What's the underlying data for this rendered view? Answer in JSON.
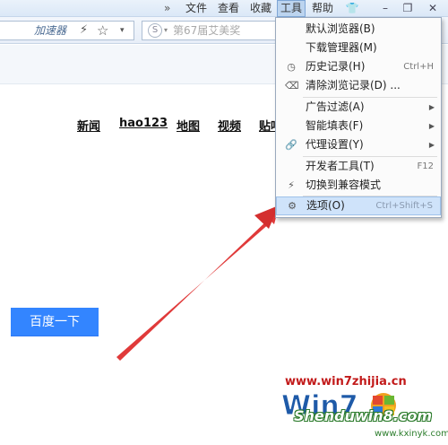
{
  "menubar": {
    "chevron": "»",
    "items": [
      "文件",
      "查看",
      "收藏",
      "工具",
      "帮助"
    ],
    "active_item": "工具",
    "shirt_icon": "👕",
    "minimize": "–",
    "restore": "❐",
    "close": "✕"
  },
  "toolbar": {
    "accelerator_label": "加速器",
    "bolt": "⚡",
    "star": "☆",
    "dropdown": "▾",
    "search_engine_icon": "S",
    "search_engine_dropdown": "▾",
    "search_placeholder": "第67届艾美奖"
  },
  "page": {
    "links": [
      "新闻",
      "hao123",
      "地图",
      "视频",
      "贴吧"
    ],
    "search_button": "百度一下"
  },
  "tools_menu": {
    "items": [
      {
        "label": "默认浏览器(B)",
        "icon": "",
        "shortcut": "",
        "submenu": false
      },
      {
        "label": "下载管理器(M)",
        "icon": "",
        "shortcut": "",
        "submenu": false
      },
      {
        "label": "历史记录(H)",
        "icon": "◷",
        "shortcut": "Ctrl+H",
        "submenu": false
      },
      {
        "label": "清除浏览记录(D) ...",
        "icon": "⌫",
        "shortcut": "",
        "submenu": false
      },
      {
        "label": "广告过滤(A)",
        "icon": "",
        "shortcut": "",
        "submenu": true
      },
      {
        "label": "智能填表(F)",
        "icon": "",
        "shortcut": "",
        "submenu": true
      },
      {
        "label": "代理设置(Y)",
        "icon": "🔗",
        "shortcut": "",
        "submenu": true
      },
      {
        "label": "开发者工具(T)",
        "icon": "",
        "shortcut": "F12",
        "submenu": false
      },
      {
        "label": "切换到兼容模式",
        "icon": "⚡",
        "shortcut": "",
        "submenu": false
      },
      {
        "label": "选项(O)",
        "icon": "⚙",
        "shortcut": "Ctrl+Shift+S",
        "submenu": false
      }
    ],
    "submenu_arrow": "▶",
    "highlighted_index": 9
  },
  "watermark": {
    "top": "www.win7zhijia.cn",
    "logo_text": "Win7",
    "bottom": "Shenduwin8.com",
    "corner": "www.kxinyk.com"
  },
  "colors": {
    "search_button": "#3385ff",
    "arrow": "#e03a3a",
    "menu_highlight": "#cfe3fa"
  }
}
